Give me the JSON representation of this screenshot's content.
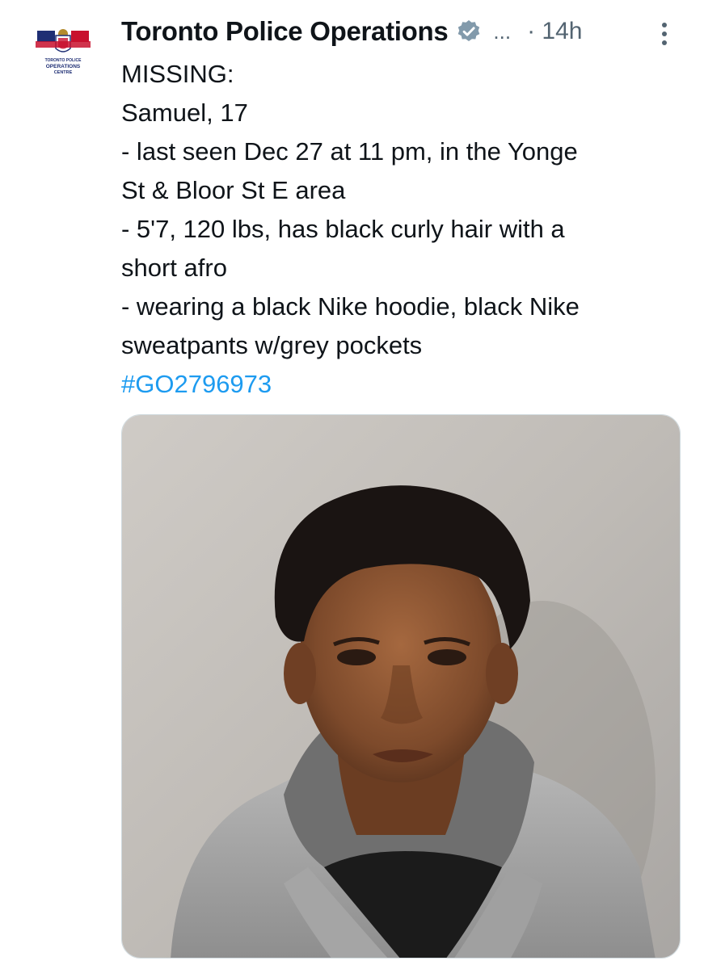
{
  "tweet": {
    "author_name": "Toronto Police Operations",
    "verified_icon": "verified-badge-icon",
    "ellipsis": "...",
    "time": "· 14h",
    "more_icon": "more-vertical-icon",
    "lines": [
      "MISSING:",
      "Samuel, 17",
      "- last seen Dec 27 at 11 pm, in the Yonge",
      "St & Bloor St E area",
      "- 5'7, 120 lbs, has black curly hair with a",
      "short afro",
      "- wearing a black Nike hoodie, black Nike",
      "sweatpants w/grey pockets"
    ],
    "hashtag": "#GO2796973"
  },
  "logo": {
    "line1": "TORONTO POLICE",
    "line2": "OPERATIONS",
    "line3": "CENTRE"
  },
  "colors": {
    "link": "#1d9bf0",
    "secondary_text": "#536471",
    "verified_badge": "#829aab",
    "flag_blue": "#1f2f74",
    "flag_red": "#c8102e"
  }
}
